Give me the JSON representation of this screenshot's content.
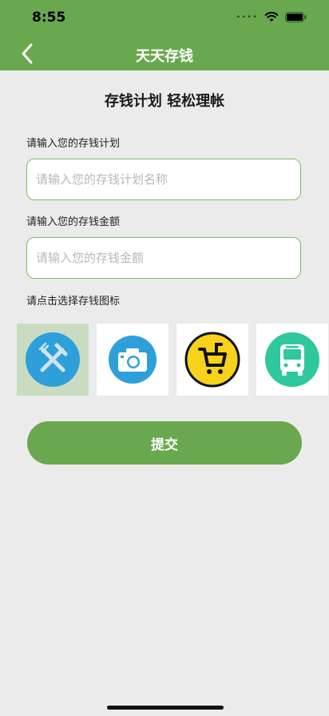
{
  "status_bar": {
    "time": "8:55"
  },
  "nav": {
    "title": "天天存钱"
  },
  "main": {
    "slogan": "存钱计划 轻松理帐",
    "plan_label": "请输入您的存钱计划",
    "plan_placeholder": "请输入您的存钱计划名称",
    "plan_value": "",
    "amount_label": "请输入您的存钱金额",
    "amount_placeholder": "请输入您的存钱金额",
    "amount_value": "",
    "icon_label": "请点击选择存钱图标",
    "icons": [
      {
        "name": "fork-knife-icon",
        "color": "#2ea0d9",
        "selected": true
      },
      {
        "name": "camera-icon",
        "color": "#2ea0d9",
        "selected": false
      },
      {
        "name": "shopping-cart-icon",
        "color": "#f7d21a",
        "selected": false
      },
      {
        "name": "bus-icon",
        "color": "#2fc79c",
        "selected": false
      }
    ],
    "submit_label": "提交"
  },
  "colors": {
    "accent": "#6aa84f",
    "input_border": "#7fba62",
    "background": "#ebebeb"
  }
}
